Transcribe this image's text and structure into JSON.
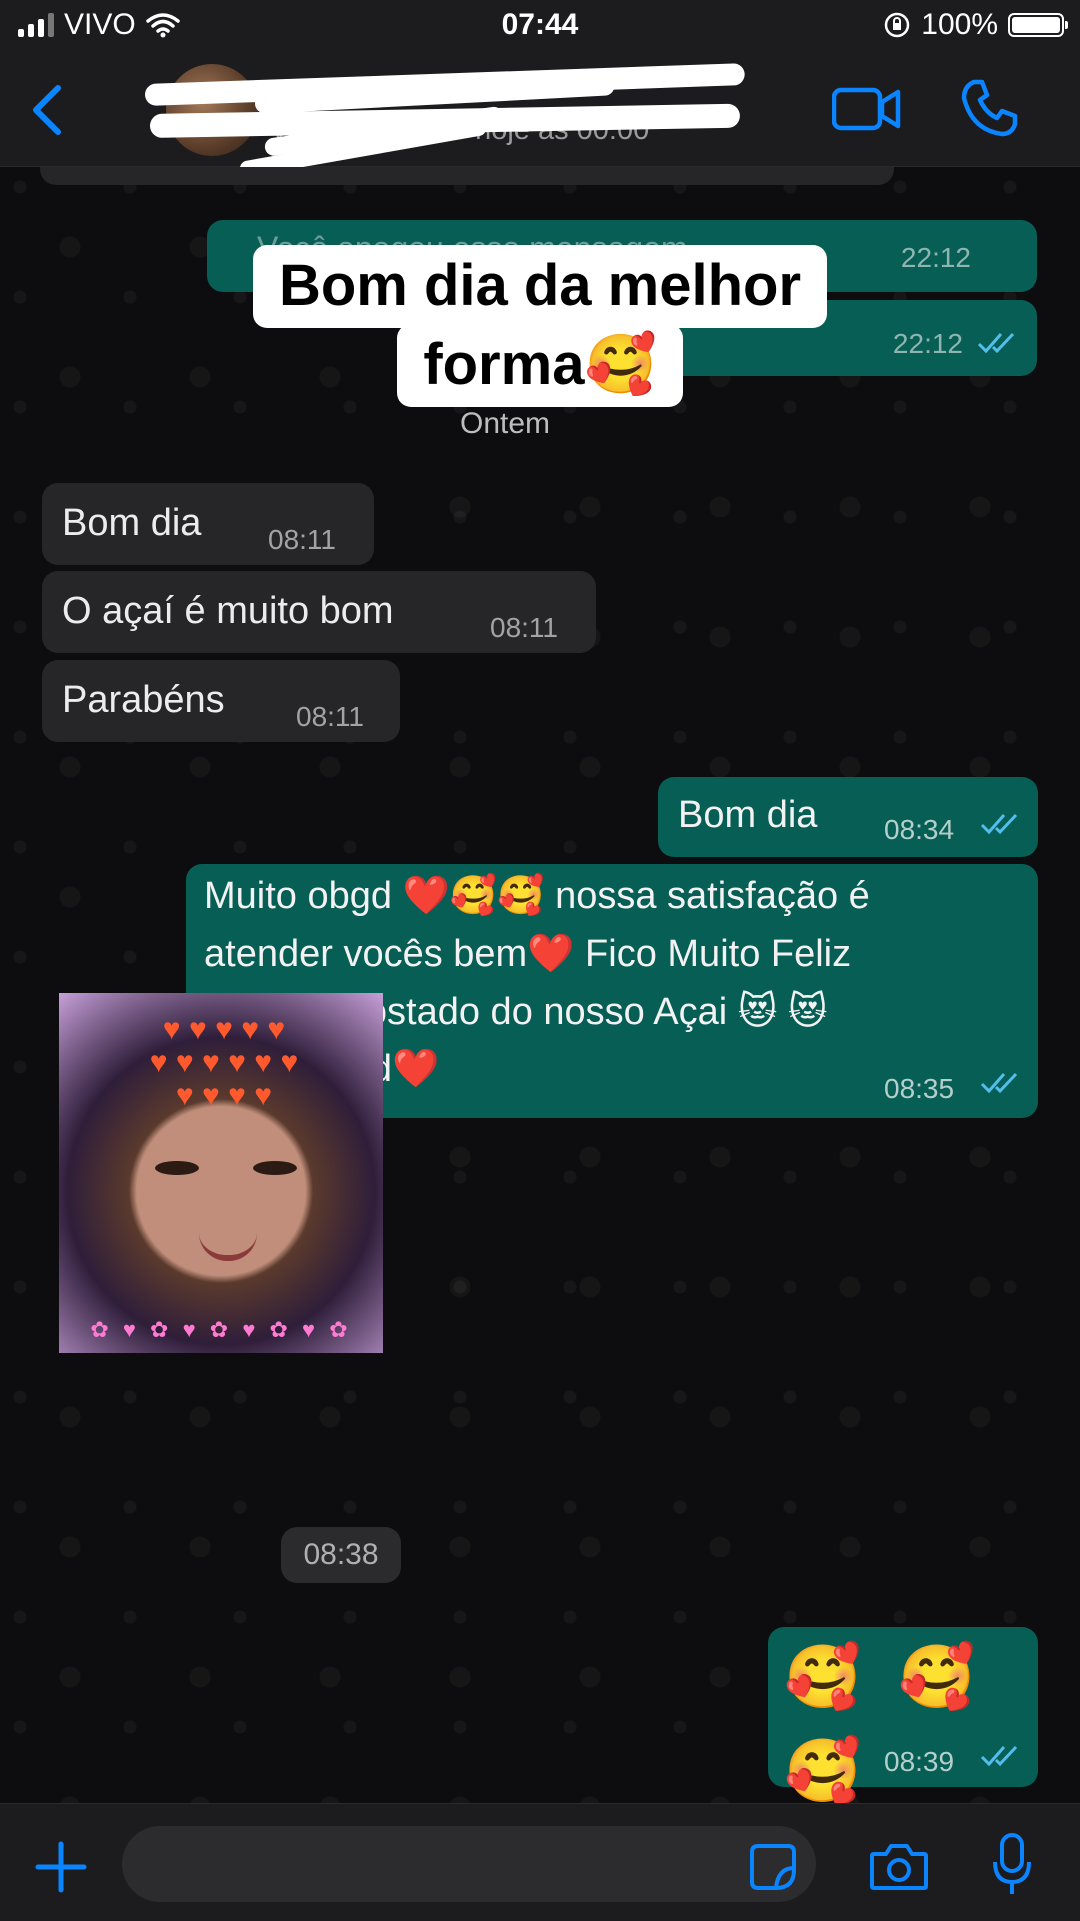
{
  "status_bar": {
    "carrier": "VIVO",
    "time": "07:44",
    "battery": "100%"
  },
  "header": {
    "contact_status": "visto por último hoje às 00:00"
  },
  "chat": {
    "faded_deleted_message": "Você apagou essa mensagem",
    "faded_time_1": "22:12",
    "faded_time_2": "22:12",
    "date_divider": "Ontem",
    "incoming": [
      {
        "text": "Bom dia",
        "time": "08:11"
      },
      {
        "text": "O açaí é muito bom",
        "time": "08:11"
      },
      {
        "text": "Parabéns",
        "time": "08:11"
      }
    ],
    "outgoing_1": {
      "text": "Bom dia",
      "time": "08:34"
    },
    "outgoing_2": {
      "lines": [
        "Muito obgd ❤️🥰🥰 nossa satisfação é",
        "atender vocês bem❤️ Fico Muito Feliz",
        "Por Ter Gostado do nosso Açai 😻 😻",
        "muito obgd❤️"
      ],
      "time": "08:35"
    },
    "sticker_time": "08:38",
    "outgoing_3": {
      "text": "🥰 🥰 🥰",
      "time": "08:39"
    }
  },
  "caption": {
    "line1": "Bom dia da melhor",
    "line2": "forma🥰"
  },
  "input": {
    "placeholder": ""
  },
  "colors": {
    "accent": "#0a84ff",
    "outgoing_bubble": "#075e55",
    "incoming_bubble": "#262628",
    "read_ticks": "#53bdeb"
  }
}
